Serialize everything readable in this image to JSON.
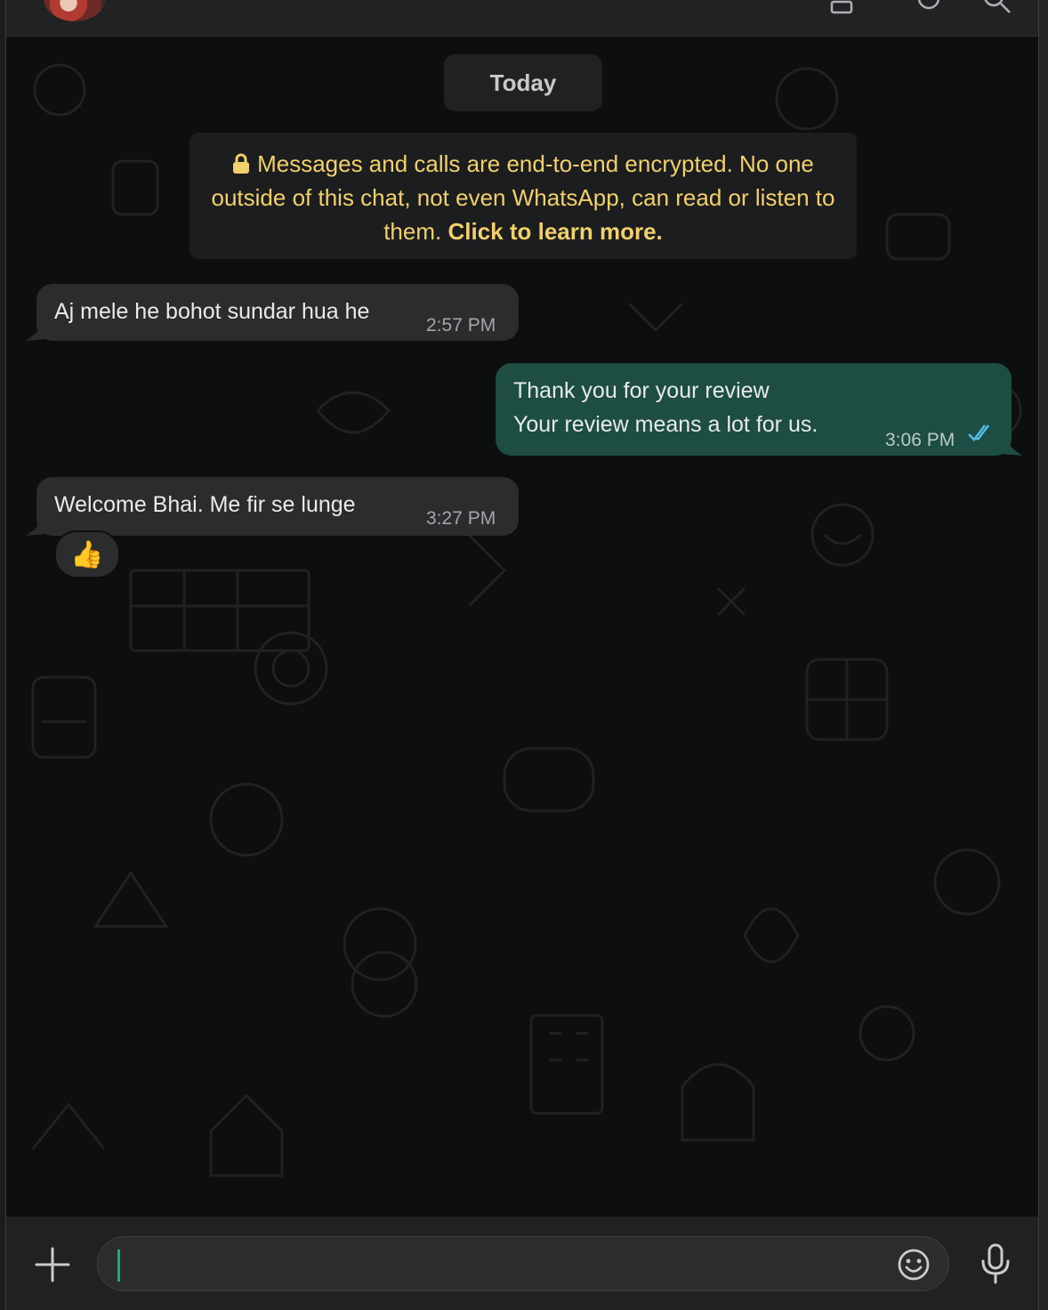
{
  "chat": {
    "date_label": "Today",
    "encryption_notice": {
      "text": "Messages and calls are end-to-end encrypted. No one outside of this chat, not even WhatsApp, can read or listen to them.",
      "link": "Click to learn more."
    },
    "messages": [
      {
        "direction": "incoming",
        "text": "Aj mele he bohot sundar hua he",
        "time": "2:57 PM"
      },
      {
        "direction": "outgoing",
        "lines": [
          "Thank you for your review",
          "Your review means a lot for us."
        ],
        "time": "3:06 PM",
        "status": "read"
      },
      {
        "direction": "incoming",
        "text": "Welcome Bhai. Me fir se lunge",
        "time": "3:27 PM",
        "reaction": "👍"
      }
    ]
  },
  "composer": {
    "input_value": "",
    "icons": [
      "plus-icon",
      "emoji-icon",
      "microphone-icon"
    ]
  },
  "colors": {
    "incoming_bubble": "#2a2c2d",
    "outgoing_bubble": "#1d4d43",
    "encryption_text": "#f2d06b",
    "read_ticks": "#53bdeb",
    "cursor": "#25a77d"
  }
}
